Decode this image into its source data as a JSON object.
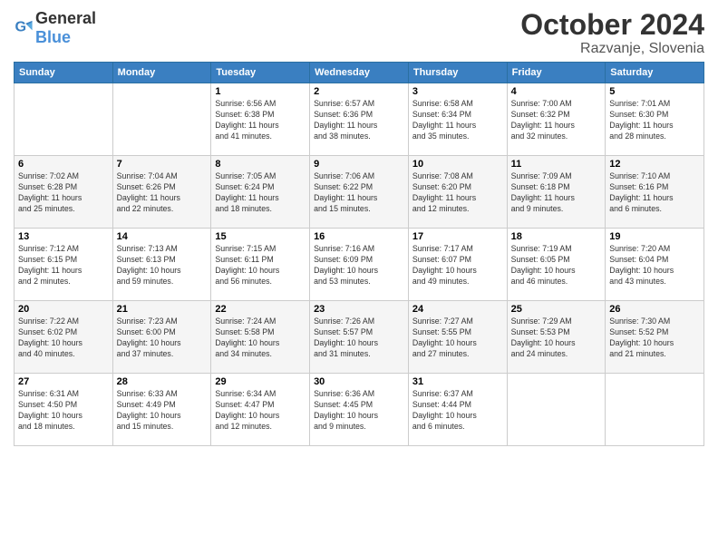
{
  "logo": {
    "text_general": "General",
    "text_blue": "Blue"
  },
  "header": {
    "month": "October 2024",
    "location": "Razvanje, Slovenia"
  },
  "weekdays": [
    "Sunday",
    "Monday",
    "Tuesday",
    "Wednesday",
    "Thursday",
    "Friday",
    "Saturday"
  ],
  "weeks": [
    [
      {
        "day": "",
        "info": ""
      },
      {
        "day": "",
        "info": ""
      },
      {
        "day": "1",
        "info": "Sunrise: 6:56 AM\nSunset: 6:38 PM\nDaylight: 11 hours\nand 41 minutes."
      },
      {
        "day": "2",
        "info": "Sunrise: 6:57 AM\nSunset: 6:36 PM\nDaylight: 11 hours\nand 38 minutes."
      },
      {
        "day": "3",
        "info": "Sunrise: 6:58 AM\nSunset: 6:34 PM\nDaylight: 11 hours\nand 35 minutes."
      },
      {
        "day": "4",
        "info": "Sunrise: 7:00 AM\nSunset: 6:32 PM\nDaylight: 11 hours\nand 32 minutes."
      },
      {
        "day": "5",
        "info": "Sunrise: 7:01 AM\nSunset: 6:30 PM\nDaylight: 11 hours\nand 28 minutes."
      }
    ],
    [
      {
        "day": "6",
        "info": "Sunrise: 7:02 AM\nSunset: 6:28 PM\nDaylight: 11 hours\nand 25 minutes."
      },
      {
        "day": "7",
        "info": "Sunrise: 7:04 AM\nSunset: 6:26 PM\nDaylight: 11 hours\nand 22 minutes."
      },
      {
        "day": "8",
        "info": "Sunrise: 7:05 AM\nSunset: 6:24 PM\nDaylight: 11 hours\nand 18 minutes."
      },
      {
        "day": "9",
        "info": "Sunrise: 7:06 AM\nSunset: 6:22 PM\nDaylight: 11 hours\nand 15 minutes."
      },
      {
        "day": "10",
        "info": "Sunrise: 7:08 AM\nSunset: 6:20 PM\nDaylight: 11 hours\nand 12 minutes."
      },
      {
        "day": "11",
        "info": "Sunrise: 7:09 AM\nSunset: 6:18 PM\nDaylight: 11 hours\nand 9 minutes."
      },
      {
        "day": "12",
        "info": "Sunrise: 7:10 AM\nSunset: 6:16 PM\nDaylight: 11 hours\nand 6 minutes."
      }
    ],
    [
      {
        "day": "13",
        "info": "Sunrise: 7:12 AM\nSunset: 6:15 PM\nDaylight: 11 hours\nand 2 minutes."
      },
      {
        "day": "14",
        "info": "Sunrise: 7:13 AM\nSunset: 6:13 PM\nDaylight: 10 hours\nand 59 minutes."
      },
      {
        "day": "15",
        "info": "Sunrise: 7:15 AM\nSunset: 6:11 PM\nDaylight: 10 hours\nand 56 minutes."
      },
      {
        "day": "16",
        "info": "Sunrise: 7:16 AM\nSunset: 6:09 PM\nDaylight: 10 hours\nand 53 minutes."
      },
      {
        "day": "17",
        "info": "Sunrise: 7:17 AM\nSunset: 6:07 PM\nDaylight: 10 hours\nand 49 minutes."
      },
      {
        "day": "18",
        "info": "Sunrise: 7:19 AM\nSunset: 6:05 PM\nDaylight: 10 hours\nand 46 minutes."
      },
      {
        "day": "19",
        "info": "Sunrise: 7:20 AM\nSunset: 6:04 PM\nDaylight: 10 hours\nand 43 minutes."
      }
    ],
    [
      {
        "day": "20",
        "info": "Sunrise: 7:22 AM\nSunset: 6:02 PM\nDaylight: 10 hours\nand 40 minutes."
      },
      {
        "day": "21",
        "info": "Sunrise: 7:23 AM\nSunset: 6:00 PM\nDaylight: 10 hours\nand 37 minutes."
      },
      {
        "day": "22",
        "info": "Sunrise: 7:24 AM\nSunset: 5:58 PM\nDaylight: 10 hours\nand 34 minutes."
      },
      {
        "day": "23",
        "info": "Sunrise: 7:26 AM\nSunset: 5:57 PM\nDaylight: 10 hours\nand 31 minutes."
      },
      {
        "day": "24",
        "info": "Sunrise: 7:27 AM\nSunset: 5:55 PM\nDaylight: 10 hours\nand 27 minutes."
      },
      {
        "day": "25",
        "info": "Sunrise: 7:29 AM\nSunset: 5:53 PM\nDaylight: 10 hours\nand 24 minutes."
      },
      {
        "day": "26",
        "info": "Sunrise: 7:30 AM\nSunset: 5:52 PM\nDaylight: 10 hours\nand 21 minutes."
      }
    ],
    [
      {
        "day": "27",
        "info": "Sunrise: 6:31 AM\nSunset: 4:50 PM\nDaylight: 10 hours\nand 18 minutes."
      },
      {
        "day": "28",
        "info": "Sunrise: 6:33 AM\nSunset: 4:49 PM\nDaylight: 10 hours\nand 15 minutes."
      },
      {
        "day": "29",
        "info": "Sunrise: 6:34 AM\nSunset: 4:47 PM\nDaylight: 10 hours\nand 12 minutes."
      },
      {
        "day": "30",
        "info": "Sunrise: 6:36 AM\nSunset: 4:45 PM\nDaylight: 10 hours\nand 9 minutes."
      },
      {
        "day": "31",
        "info": "Sunrise: 6:37 AM\nSunset: 4:44 PM\nDaylight: 10 hours\nand 6 minutes."
      },
      {
        "day": "",
        "info": ""
      },
      {
        "day": "",
        "info": ""
      }
    ]
  ]
}
